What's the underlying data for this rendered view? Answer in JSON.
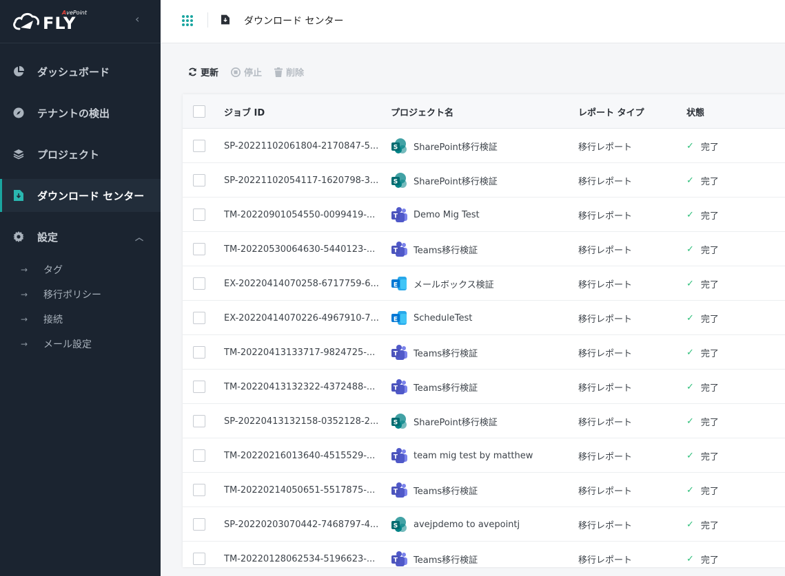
{
  "app": {
    "logo_text": "FLY",
    "brand_prefix": "A",
    "brand_rest": "vePoint"
  },
  "sidebar": {
    "items": [
      {
        "label": "ダッシュボード",
        "icon": "pie-chart-icon"
      },
      {
        "label": "テナントの検出",
        "icon": "compass-icon"
      },
      {
        "label": "プロジェクト",
        "icon": "layers-icon"
      },
      {
        "label": "ダウンロード センター",
        "icon": "download-file-icon",
        "active": true
      },
      {
        "label": "設定",
        "icon": "gear-icon"
      }
    ],
    "settings_sub": [
      {
        "label": "タグ"
      },
      {
        "label": "移行ポリシー"
      },
      {
        "label": "接続"
      },
      {
        "label": "メール設定"
      }
    ]
  },
  "header": {
    "title": "ダウンロード センター"
  },
  "toolbar": {
    "refresh_label": "更新",
    "stop_label": "停止",
    "delete_label": "削除"
  },
  "table": {
    "headers": {
      "job_id": "ジョブ ID",
      "project": "プロジェクト名",
      "report_type": "レポート タイプ",
      "status": "状態"
    },
    "rows": [
      {
        "job_id": "SP-20221102061804-2170847-5...",
        "app": "sharepoint",
        "app_letter": "S",
        "project": "SharePoint移行検証",
        "report_type": "移行レポート",
        "status": "完了"
      },
      {
        "job_id": "SP-20221102054117-1620798-3...",
        "app": "sharepoint",
        "app_letter": "S",
        "project": "SharePoint移行検証",
        "report_type": "移行レポート",
        "status": "完了"
      },
      {
        "job_id": "TM-20220901054550-0099419-...",
        "app": "teams",
        "app_letter": "T",
        "project": "Demo Mig Test",
        "report_type": "移行レポート",
        "status": "完了"
      },
      {
        "job_id": "TM-20220530064630-5440123-...",
        "app": "teams",
        "app_letter": "T",
        "project": "Teams移行検証",
        "report_type": "移行レポート",
        "status": "完了"
      },
      {
        "job_id": "EX-20220414070258-6717759-6...",
        "app": "exchange",
        "app_letter": "E",
        "project": "メールボックス検証",
        "report_type": "移行レポート",
        "status": "完了"
      },
      {
        "job_id": "EX-20220414070226-4967910-7...",
        "app": "exchange",
        "app_letter": "E",
        "project": "ScheduleTest",
        "report_type": "移行レポート",
        "status": "完了"
      },
      {
        "job_id": "TM-20220413133717-9824725-...",
        "app": "teams",
        "app_letter": "T",
        "project": "Teams移行検証",
        "report_type": "移行レポート",
        "status": "完了"
      },
      {
        "job_id": "TM-20220413132322-4372488-...",
        "app": "teams",
        "app_letter": "T",
        "project": "Teams移行検証",
        "report_type": "移行レポート",
        "status": "完了"
      },
      {
        "job_id": "SP-20220413132158-0352128-2...",
        "app": "sharepoint",
        "app_letter": "S",
        "project": "SharePoint移行検証",
        "report_type": "移行レポート",
        "status": "完了"
      },
      {
        "job_id": "TM-20220216013640-4515529-...",
        "app": "teams",
        "app_letter": "T",
        "project": "team mig test by matthew",
        "report_type": "移行レポート",
        "status": "完了"
      },
      {
        "job_id": "TM-20220214050651-5517875-...",
        "app": "teams",
        "app_letter": "T",
        "project": "Teams移行検証",
        "report_type": "移行レポート",
        "status": "完了"
      },
      {
        "job_id": "SP-20220203070442-7468797-4...",
        "app": "sharepoint",
        "app_letter": "S",
        "project": "avejpdemo to avepointj",
        "report_type": "移行レポート",
        "status": "完了"
      },
      {
        "job_id": "TM-20220128062534-5196623-...",
        "app": "teams",
        "app_letter": "T",
        "project": "Teams移行検証",
        "report_type": "移行レポート",
        "status": "完了"
      }
    ]
  },
  "colors": {
    "sidebar_bg": "#1b2430",
    "accent": "#1aa5a0",
    "success": "#2ebf7a",
    "sharepoint": "#038387",
    "teams": "#5059c9",
    "exchange": "#0078d4"
  }
}
